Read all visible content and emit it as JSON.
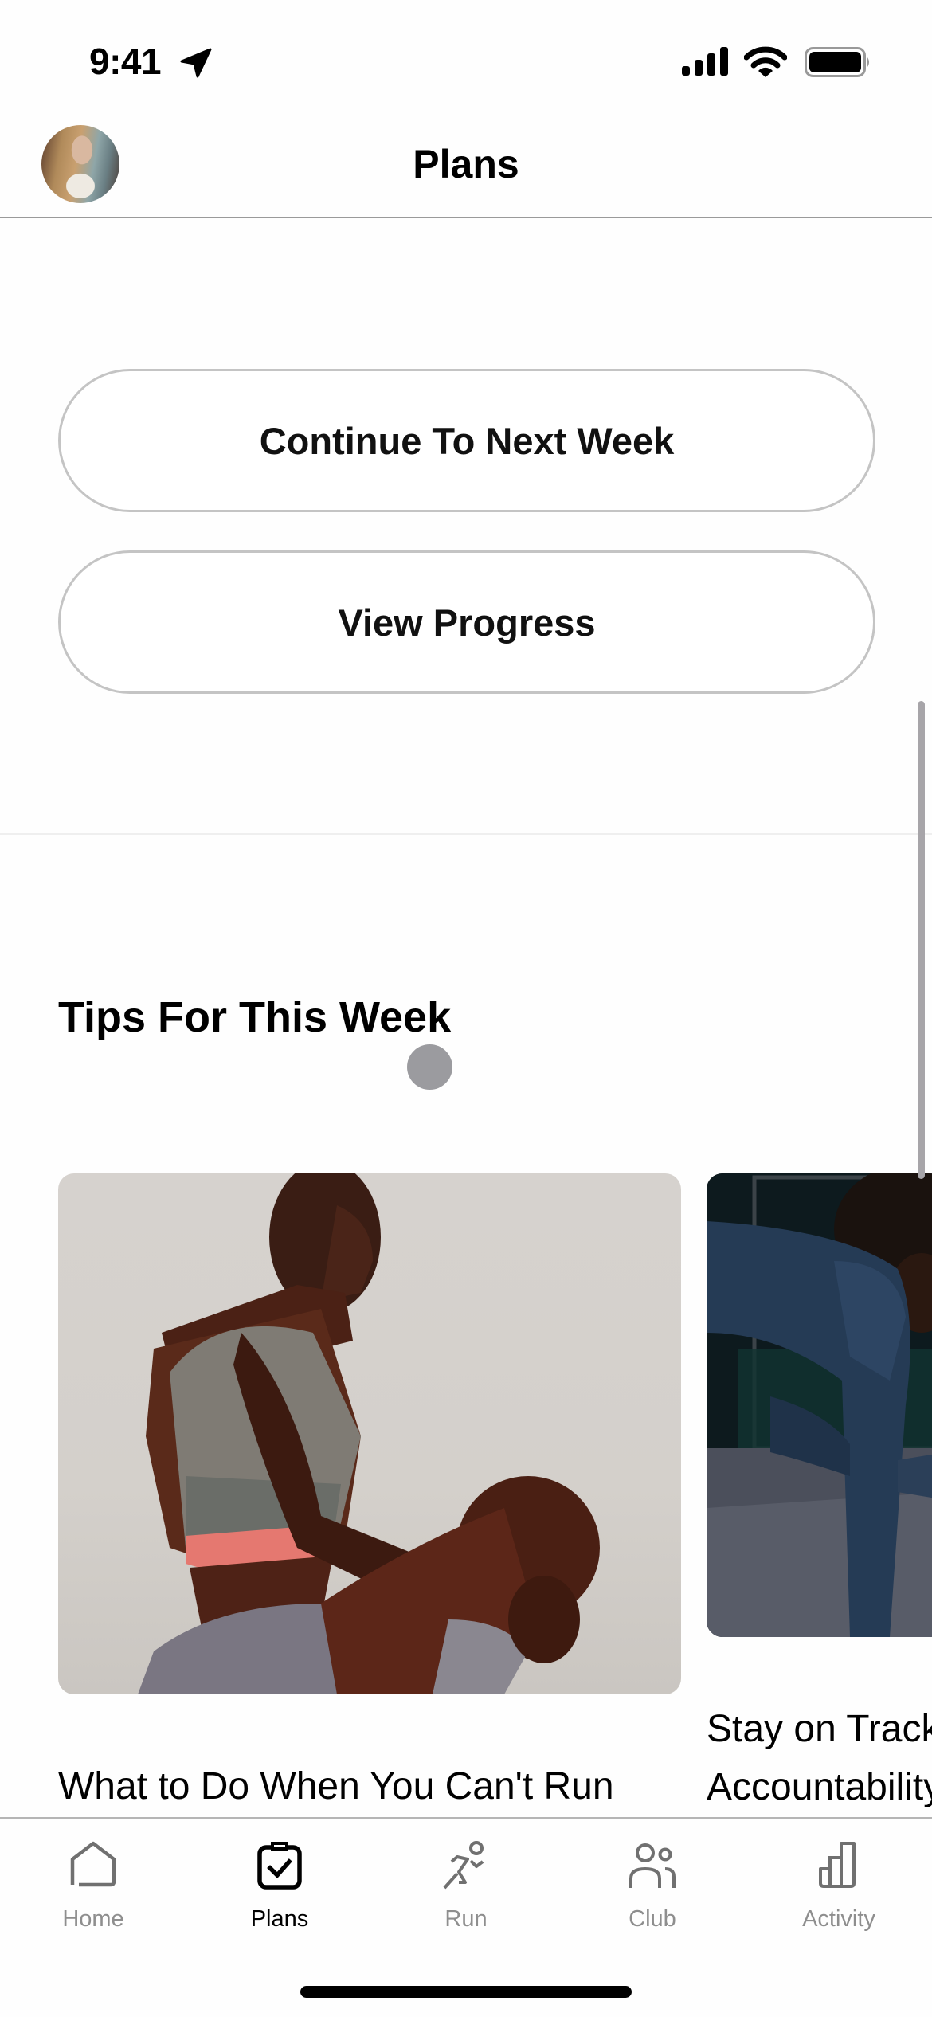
{
  "status_bar": {
    "time": "9:41",
    "icons": [
      "location-arrow-icon",
      "cellular-signal-icon",
      "wifi-icon",
      "battery-icon"
    ]
  },
  "header": {
    "title": "Plans",
    "avatar": "profile-avatar"
  },
  "actions": {
    "continue_label": "Continue To Next Week",
    "progress_label": "View Progress"
  },
  "tips": {
    "title": "Tips For This Week",
    "cards": [
      {
        "title_lines": [
          "What to Do When You Can't Run"
        ],
        "image": "athlete-stretching-photo"
      },
      {
        "title_lines": [
          "Stay on Track",
          "Accountability"
        ],
        "image": "athlete-workout-photo"
      }
    ]
  },
  "tab_bar": {
    "items": [
      {
        "label": "Home",
        "icon": "home-icon",
        "active": false
      },
      {
        "label": "Plans",
        "icon": "clipboard-check-icon",
        "active": true
      },
      {
        "label": "Run",
        "icon": "runner-icon",
        "active": false
      },
      {
        "label": "Club",
        "icon": "people-icon",
        "active": false
      },
      {
        "label": "Activity",
        "icon": "bar-chart-icon",
        "active": false
      }
    ]
  },
  "colors": {
    "text_primary": "#000000",
    "tab_inactive": "#8e8e8e",
    "button_border": "#c4c4c4",
    "touch_indicator": "#9b9b9f"
  }
}
